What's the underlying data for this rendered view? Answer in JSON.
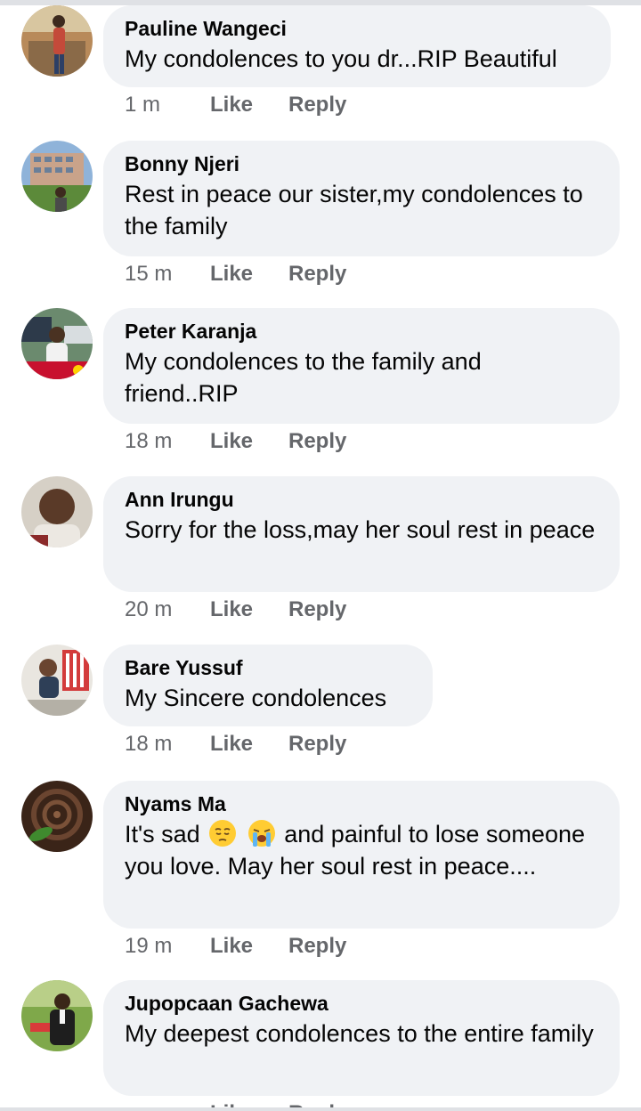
{
  "comments": [
    {
      "author": "Pauline Wangeci",
      "text": "My condolences to you dr...RIP Beautiful",
      "time": "1 m",
      "like_label": "Like",
      "reply_label": "Reply"
    },
    {
      "author": "Bonny Njeri",
      "text": "Rest in peace our sister,my condolences to the family",
      "time": "15 m",
      "like_label": "Like",
      "reply_label": "Reply"
    },
    {
      "author": "Peter Karanja",
      "text": "My condolences to the family and friend..RIP",
      "time": "18 m",
      "like_label": "Like",
      "reply_label": "Reply"
    },
    {
      "author": "Ann Irungu",
      "text": "Sorry for the loss,may her soul rest in peace",
      "time": "20 m",
      "like_label": "Like",
      "reply_label": "Reply"
    },
    {
      "author": "Bare Yussuf",
      "text": "My Sincere condolences",
      "time": "18 m",
      "like_label": "Like",
      "reply_label": "Reply"
    },
    {
      "author": "Nyams Ma",
      "text_part1": "It's sad",
      "text_part2": "and painful to lose someone you love. May her soul rest in peace....",
      "emojis": [
        "pensive-face-emoji",
        "loudly-crying-face-emoji"
      ],
      "time": "19 m",
      "like_label": "Like",
      "reply_label": "Reply"
    },
    {
      "author": "Jupopcaan Gachewa",
      "text": "My deepest condolences to the entire family",
      "time": "",
      "like_label": "Like",
      "reply_label": "Reply"
    }
  ]
}
